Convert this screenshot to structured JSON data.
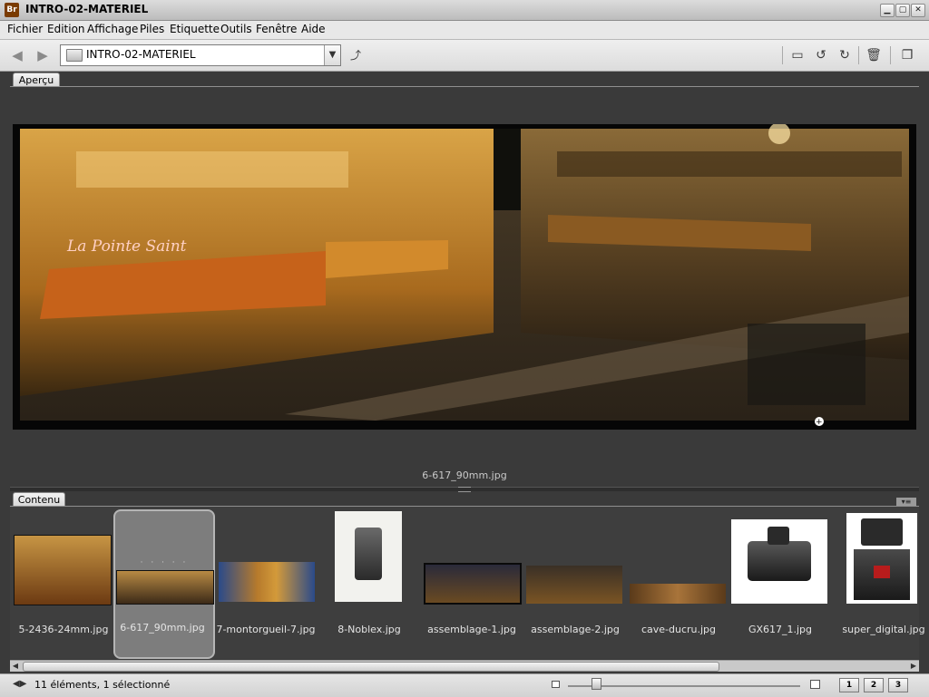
{
  "window": {
    "title": "INTRO-02-MATERIEL",
    "app_icon_text": "Br"
  },
  "menu": [
    "Fichier",
    "Edition",
    "Affichage",
    "Piles",
    "Etiquette",
    "Outils",
    "Fenêtre",
    "Aide"
  ],
  "toolbar": {
    "path": "INTRO-02-MATERIEL"
  },
  "preview_panel": {
    "tab_label": "Aperçu",
    "caption": "6-617_90mm.jpg"
  },
  "content_panel": {
    "tab_label": "Contenu",
    "items": [
      {
        "name": "5-2436-24mm.jpg",
        "selected": false
      },
      {
        "name": "6-617_90mm.jpg",
        "selected": true
      },
      {
        "name": "7-montorgueil-7.jpg",
        "selected": false
      },
      {
        "name": "8-Noblex.jpg",
        "selected": false
      },
      {
        "name": "assemblage-1.jpg",
        "selected": false
      },
      {
        "name": "assemblage-2.jpg",
        "selected": false
      },
      {
        "name": "cave-ducru.jpg",
        "selected": false
      },
      {
        "name": "GX617_1.jpg",
        "selected": false
      },
      {
        "name": "super_digital.jpg",
        "selected": false
      }
    ]
  },
  "statusbar": {
    "text": "11 éléments, 1 sélectionné",
    "view_buttons": [
      "1",
      "2",
      "3"
    ]
  },
  "colors": {
    "panel_bg": "#3a3a3a",
    "selection_bg": "#7d7d7d"
  }
}
